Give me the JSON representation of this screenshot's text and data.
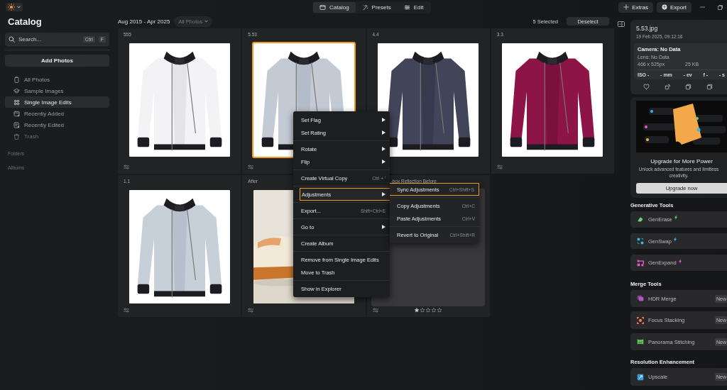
{
  "topbar": {
    "tabs": [
      {
        "label": "Catalog",
        "selected": true
      },
      {
        "label": "Presets",
        "selected": false
      },
      {
        "label": "Edit",
        "selected": false
      }
    ],
    "actions": [
      "Extras",
      "Export"
    ]
  },
  "sidebar": {
    "title": "Catalog",
    "search": {
      "placeholder": "Search...",
      "keys": [
        "Ctrl",
        "F"
      ]
    },
    "add_button": "Add Photos",
    "items": [
      {
        "label": "All Photos",
        "selected": false,
        "disabled": false
      },
      {
        "label": "Sample Images",
        "selected": false,
        "disabled": false
      },
      {
        "label": "Single Image Edits",
        "selected": true,
        "disabled": false
      },
      {
        "label": "Recently Added",
        "selected": false,
        "disabled": false
      },
      {
        "label": "Recently Edited",
        "selected": false,
        "disabled": false
      },
      {
        "label": "Trash",
        "selected": false,
        "disabled": true
      }
    ],
    "sections": [
      "Folders",
      "Albums"
    ]
  },
  "toolbar": {
    "date_range": "Aug 2015 - Apr 2025",
    "filter": "All Photos",
    "selection_count": "5 Selected",
    "deselect": "Deselect"
  },
  "photos": [
    {
      "caption": "555",
      "kind": "picture",
      "selected": false
    },
    {
      "caption": "5.53",
      "kind": "picture",
      "selected": true
    },
    {
      "caption": "4.4",
      "kind": "picture",
      "selected": false
    },
    {
      "caption": "3.3",
      "kind": "picture",
      "selected": false
    },
    {
      "caption": "1.1",
      "kind": "picture",
      "selected": false
    },
    {
      "caption": "After",
      "kind": "picture",
      "selected": false
    },
    {
      "caption": "-box Reflection Before",
      "kind": "empty",
      "selected": false,
      "stars": 1
    }
  ],
  "context_menu": {
    "groups": [
      {
        "items": [
          {
            "label": "Set Flag",
            "submenu": true,
            "selected": false
          },
          {
            "label": "Set Rating",
            "submenu": true,
            "selected": false
          }
        ]
      },
      {
        "items": [
          {
            "label": "Rotate",
            "submenu": true,
            "selected": false
          },
          {
            "label": "Flip",
            "submenu": true,
            "selected": false
          }
        ]
      },
      {
        "items": [
          {
            "label": "Create Virtual Copy",
            "shortcut": "Ctrl + '",
            "submenu": false,
            "selected": false
          }
        ]
      },
      {
        "items": [
          {
            "label": "Adjustments",
            "submenu": true,
            "selected": true
          }
        ]
      },
      {
        "items": [
          {
            "label": "Export...",
            "shortcut": "Shift+Ctrl+E",
            "submenu": false,
            "selected": false
          }
        ]
      },
      {
        "items": [
          {
            "label": "Go to",
            "submenu": true,
            "selected": false
          }
        ]
      },
      {
        "items": [
          {
            "label": "Create Album",
            "submenu": false,
            "selected": false
          }
        ]
      },
      {
        "items": [
          {
            "label": "Remove from Single Image Edits",
            "submenu": false,
            "selected": false
          },
          {
            "label": "Move to Trash",
            "submenu": false,
            "selected": false
          }
        ]
      },
      {
        "items": [
          {
            "label": "Show in Explorer",
            "submenu": false,
            "selected": false
          }
        ]
      }
    ]
  },
  "submenu": {
    "groups": [
      {
        "items": [
          {
            "label": "Sync Adjustments",
            "shortcut": "Ctrl+Shift+S",
            "selected": true
          }
        ]
      },
      {
        "items": [
          {
            "label": "Copy Adjustments",
            "shortcut": "Ctrl+C",
            "selected": false
          },
          {
            "label": "Paste Adjustments",
            "shortcut": "Ctrl+V",
            "selected": false
          }
        ]
      },
      {
        "items": [
          {
            "label": "Revert to Original",
            "shortcut": "Ctrl+Shift+R",
            "selected": false
          }
        ]
      }
    ]
  },
  "info": {
    "filename": "5.53.jpg",
    "date": "19 Feb 2025, 09:12:16",
    "camera": "Camera: No Data",
    "lens": "Lens: No Data",
    "dimensions": "466 x 525px",
    "size": "25 KB",
    "exif": [
      "ISO -",
      "- mm",
      "- ev",
      "f -",
      "- s"
    ]
  },
  "promo": {
    "title": "Upgrade for More Power",
    "text": "Unlock advanced features and limitless creativity.",
    "button": "Upgrade now"
  },
  "tool_sections": [
    {
      "title": "Generative Tools",
      "tools": [
        {
          "label": "GenErase",
          "color": "#6ad27c",
          "bolt": true
        },
        {
          "label": "GenSwap",
          "color": "#3cb8ea",
          "bolt": true
        },
        {
          "label": "GenExpand",
          "color": "#e45ad6",
          "bolt": true
        }
      ]
    },
    {
      "title": "Merge Tools",
      "tools": [
        {
          "label": "HDR Merge",
          "color": "#b257c2",
          "badge": "New"
        },
        {
          "label": "Focus Stacking",
          "color": "#ee7a4c",
          "badge": "New"
        },
        {
          "label": "Panorama Stitching",
          "color": "#5cc85c",
          "badge": "New"
        }
      ]
    },
    {
      "title": "Resolution Enhancement",
      "tools": [
        {
          "label": "Upscale",
          "color": "#3a9be2",
          "badge": "New"
        }
      ]
    }
  ]
}
